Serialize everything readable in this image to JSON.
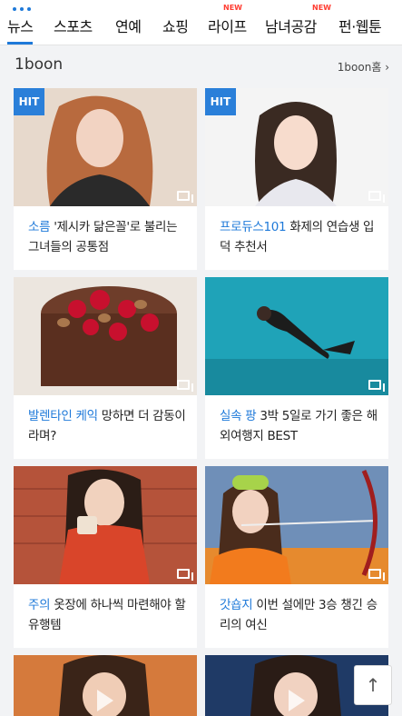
{
  "nav": {
    "items": [
      {
        "label": "뉴스",
        "new": ""
      },
      {
        "label": "스포츠",
        "new": ""
      },
      {
        "label": "연예",
        "new": ""
      },
      {
        "label": "쇼핑",
        "new": ""
      },
      {
        "label": "라이프",
        "new": "NEW"
      },
      {
        "label": "남녀공감",
        "new": "NEW"
      },
      {
        "label": "펀·웹툰",
        "new": ""
      }
    ]
  },
  "section": {
    "title": "1boon",
    "link": "1boon홈 ›"
  },
  "cards": [
    {
      "hit": "HIT",
      "keyword": "소름",
      "text": "'제시카 닮은꼴'로 불리는 그녀들의 공통점"
    },
    {
      "hit": "HIT",
      "keyword": "프로듀스101",
      "text": "화제의 연습생 입덕 추천서"
    },
    {
      "hit": "",
      "keyword": "발렌타인 케익",
      "text": "망하면 더 감동이라며?"
    },
    {
      "hit": "",
      "keyword": "실속 팡",
      "text": "3박 5일로 가기 좋은 해외여행지 BEST"
    },
    {
      "hit": "",
      "keyword": "주의",
      "text": "옷장에 하나씩 마련해야 할 유행템"
    },
    {
      "hit": "",
      "keyword": "갓숍지",
      "text": "이번 설에만 3승 챙긴 승리의 여신"
    }
  ],
  "buttons": {
    "top": "↑"
  },
  "icons": {
    "gallery": "gallery-icon",
    "play": "play-icon",
    "arrow_up": "arrow-up-icon"
  },
  "colors": {
    "accent": "#1e79d9",
    "new_badge": "#ff3b30"
  }
}
